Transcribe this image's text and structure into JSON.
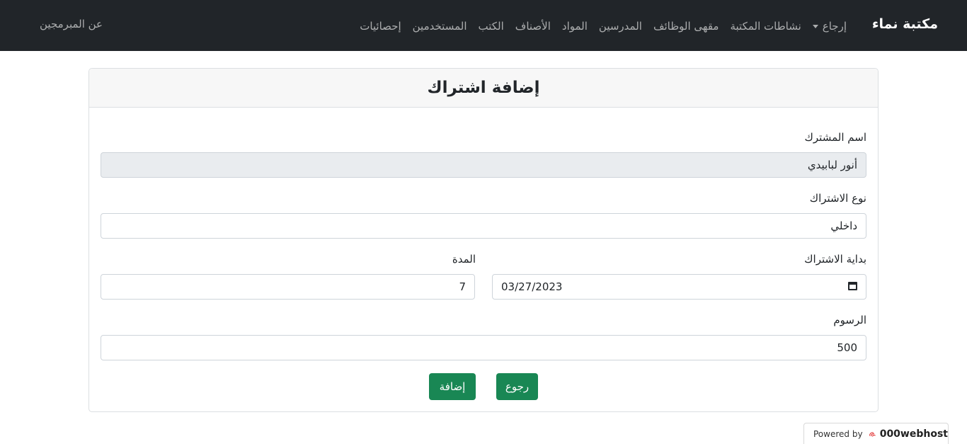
{
  "navbar": {
    "brand": "مكتبة نماء",
    "links": [
      {
        "label": "إحصائيات"
      },
      {
        "label": "المستخدمين"
      },
      {
        "label": "الكتب"
      },
      {
        "label": "الأصناف"
      },
      {
        "label": "المواد"
      },
      {
        "label": "المدرسين"
      },
      {
        "label": "مقهى الوظائف"
      },
      {
        "label": "نشاطات المكتبة"
      }
    ],
    "dropdown_label": "إرجاع",
    "about": "عن المبرمجين"
  },
  "form": {
    "title": "إضافة اشتراك",
    "subscriber_name": {
      "label": "اسم المشترك",
      "value": "أنور لبابيدي"
    },
    "subscription_type": {
      "label": "نوع الاشتراك",
      "value": "داخلي"
    },
    "start_date": {
      "label": "بداية الاشتراك",
      "value": "03/27/2023"
    },
    "duration": {
      "label": "المدة",
      "value": "7"
    },
    "fees": {
      "label": "الرسوم",
      "value": "500"
    },
    "back_button": "رجوع",
    "add_button": "إضافة"
  },
  "footer_badge": {
    "powered_by": "Powered by",
    "brand": "000webhost"
  },
  "colors": {
    "navbar_bg": "#212529",
    "accent_green": "#198754",
    "readonly_bg": "#e9ecef"
  }
}
